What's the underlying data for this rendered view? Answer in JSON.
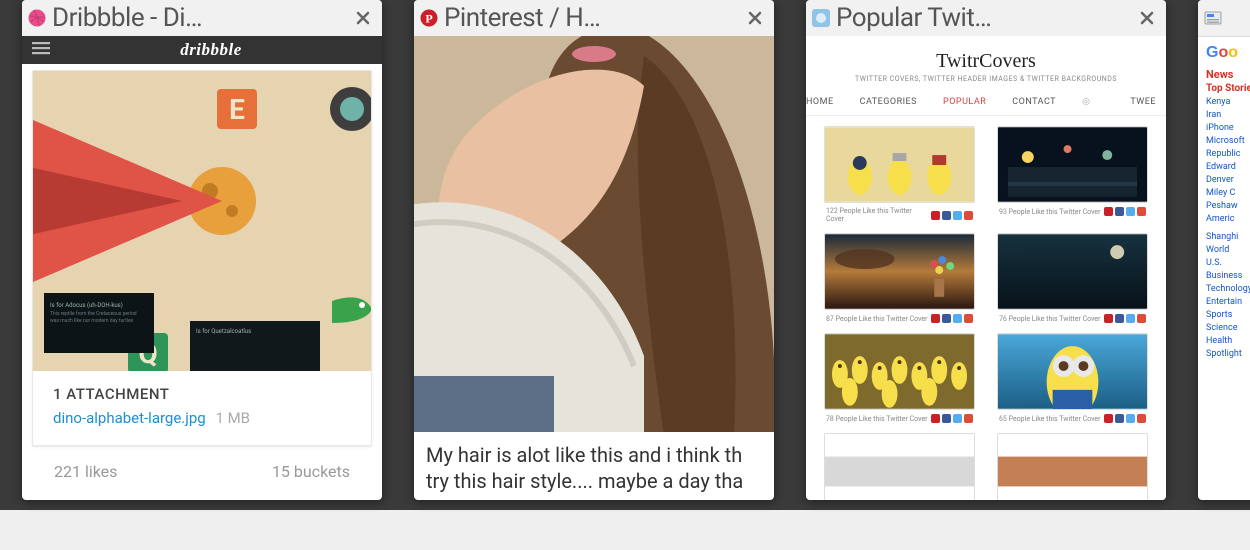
{
  "tabs": [
    {
      "title": "Dribbble - Di…",
      "close_name": "tab1-close"
    },
    {
      "title": "Pinterest / H…",
      "close_name": "tab2-close"
    },
    {
      "title": "Popular Twit…",
      "close_name": "tab3-close"
    },
    {
      "title": "",
      "close_name": "tab4-close"
    }
  ],
  "dribbble": {
    "logo": "dribbble",
    "attachment_header": "1 ATTACHMENT",
    "file_name": "dino-alphabet-large.jpg",
    "file_size": "1 MB",
    "likes": "221 likes",
    "buckets": "15 buckets"
  },
  "pinterest": {
    "caption": "My hair is alot like this and i think th try this hair style.... maybe a day tha"
  },
  "twitrcovers": {
    "title": "TwitrCovers",
    "subtitle": "TWITTER COVERS, TWITTER HEADER IMAGES & TWITTER BACKGROUNDS",
    "nav": [
      "HOME",
      "CATEGORIES",
      "POPULAR",
      "CONTACT"
    ],
    "extra_nav": "TWEE",
    "cells": [
      {
        "likes": "122 People Like this Twitter Cover"
      },
      {
        "likes": "93 People Like this Twitter Cover"
      },
      {
        "likes": "87 People Like this Twitter Cover"
      },
      {
        "likes": "76 People Like this Twitter Cover"
      },
      {
        "likes": "78 People Like this Twitter Cover"
      },
      {
        "likes": "65 People Like this Twitter Cover"
      }
    ]
  },
  "gnews": {
    "news_label": "News",
    "top_stories": "Top Stories",
    "headlines": [
      "Kenya",
      "Iran",
      "iPhone",
      "Microsoft",
      "Republic",
      "Edward",
      "Denver",
      "Miley C",
      "Peshaw",
      "Americ"
    ],
    "sections": [
      "Shanghi",
      "World",
      "U.S.",
      "Business",
      "Technology",
      "Entertain",
      "Sports",
      "Science",
      "Health",
      "Spotlight"
    ]
  }
}
